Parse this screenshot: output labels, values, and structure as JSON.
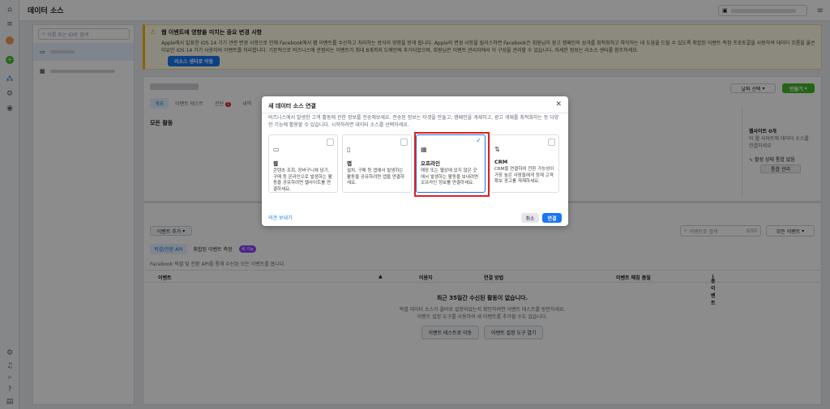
{
  "window": {
    "title": "데이터 소스"
  },
  "left_panel": {
    "search_placeholder": "이름 또는 ID로 검색"
  },
  "banner": {
    "title": "웹 이벤트에 영향을 미치는 중요 변경 사항",
    "body": "Apple에서 발표한 iOS 14 기기 관련 변경 사항으로 인해 Facebook에서 웹 이벤트를 수신하고 처리하는 방식이 영향을 받게 됩니다. Apple의 변경 사항을 릴리스하면 Facebook은 회원님이 광고 캠페인의 성과를 최적화하고 파악하는 데 도움을 드릴 수 있도록 취합된 이벤트 측정 프로토콜을 사용하여 데이터 흐름을 옮은 이유만 iOS 14 기기 사용자의 이벤트를 처리합니다. 기본적으로 비즈니스에 관점되는 이벤트가 최대 8개까지 도메인에 추가되었으며, 회원님은 이벤트 관리자에서 이 구성을 관리할 수 있습니다. 자세한 정보는 리소스 센터를 참조하세요.",
    "button": "리소스 센터로 이동"
  },
  "overview_card": {
    "tabs": [
      "개요",
      "이벤트 테스트",
      "진단",
      "내역"
    ],
    "diag_badge": "1",
    "activity_title": "모든 활동",
    "date_button": "날짜 선택",
    "create_button": "만들기",
    "side_websites": "웹사이트 0개",
    "side_websites_sub": "이 웹 사이트에 데이터 소스를 연결하세요",
    "side_status": "활성 상태 통합 없음",
    "side_manage": "통합 관리"
  },
  "events_section": {
    "add_event": "이벤트 추가",
    "search_placeholder": "이벤트로 검색",
    "count": "0/50",
    "all_events": "모든 이벤트",
    "tabs": [
      "픽셀/전환 API",
      "취합된 이벤트 측정"
    ],
    "new_badge": "새 기능",
    "description": "Facebook 픽셀 및 전환 API를 통해 수신된 모든 이벤트를 봅니다.",
    "columns": [
      "이벤트",
      "이용자",
      "연결 방법",
      "이벤트 매칭 품질",
      "총 이벤트"
    ],
    "empty_title": "최근 35일간 수신된 활동이 없습니다.",
    "empty_desc_1": "픽셀 데이터 소스가 올바로 설정되었는지 확인하려면 이벤트 테스트를 방문하세요.",
    "empty_desc_2": "이벤트 설정 도구를 사용하여 새 이벤트를 추가할 수도 있습니다.",
    "btn_test": "이벤트 테스트로 이동",
    "btn_setup": "이벤트 설정 도구 열기"
  },
  "modal": {
    "title": "새 데이터 소스 연결",
    "description": "비즈니스에서 발생한 고객 활동에 관한 정보를 전송해보세요. 전송된 정보는 타겟을 만들고, 캠페인을 게재하고, 광고 게재를 최적화하는 등 다양한 기능에 활용할 수 있습니다. 시작하려면 데이터 소스를 선택하세요.",
    "options": [
      {
        "title": "웹",
        "desc": "콘텐츠 조회, 장바구니에 담기, 구매 등 온라인으로 발생하는 활동을 공유하려면 웹사이트를 연결하세요.",
        "icon": "laptop-icon"
      },
      {
        "title": "앱",
        "desc": "설치, 구매 등 앱에서 발생하는 활동을 공유하려면 앱을 연결하세요.",
        "icon": "phone-icon"
      },
      {
        "title": "오프라인",
        "desc": "매장 또는 웹상에 있지 않은 곳에서 발생하는 활동을 보내려면 오프라인 정보를 연결하세요.",
        "icon": "store-icon"
      },
      {
        "title": "CRM",
        "desc": "CRM을 연결하여 전환 가능성이 가장 높은 사람들에게 정재 고객 확보 광고를 게재하세요.",
        "icon": "crm-icon"
      }
    ],
    "feedback": "의견 보내기",
    "cancel": "취소",
    "connect": "연결"
  }
}
